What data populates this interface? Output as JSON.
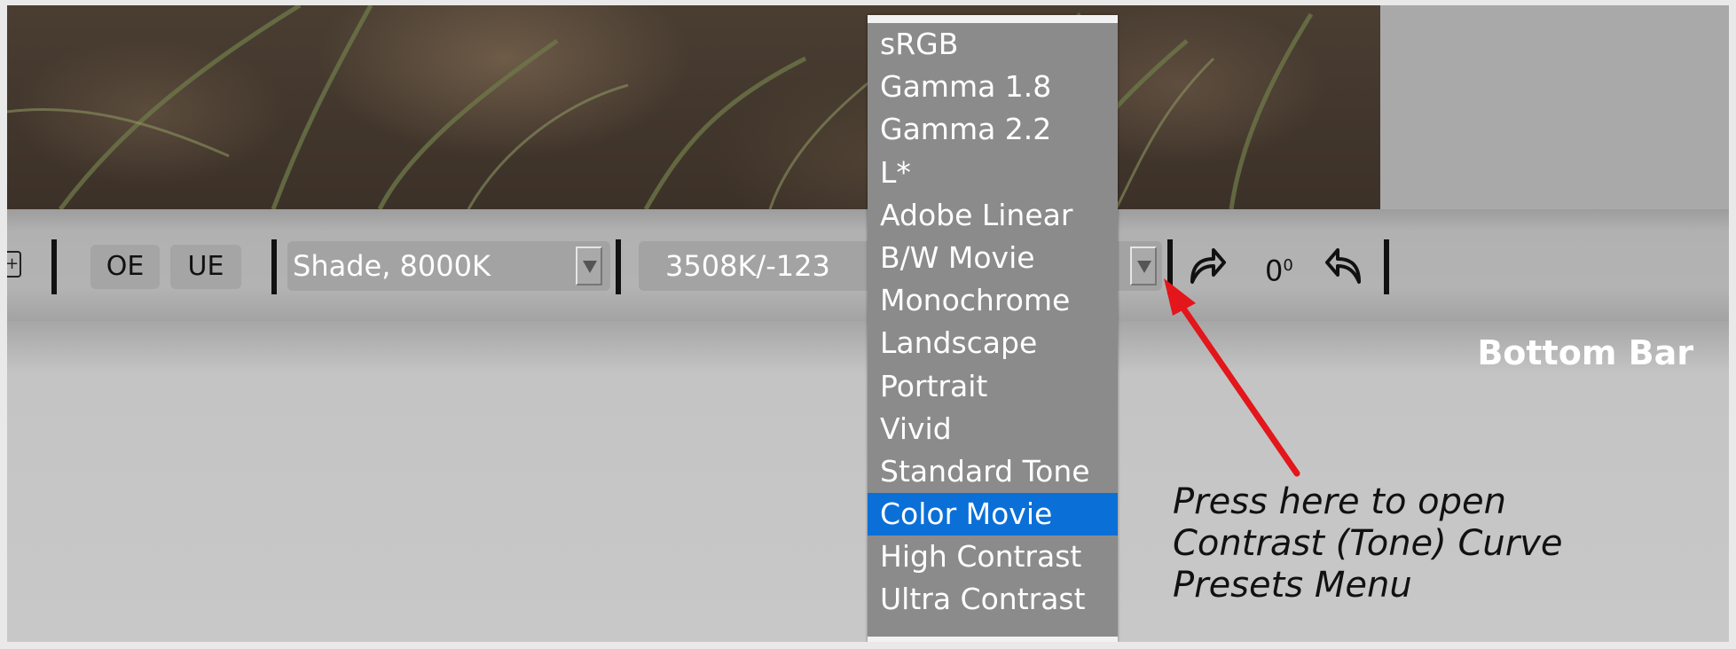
{
  "bottom_bar": {
    "oe_label": "OE",
    "ue_label": "UE",
    "wb_preset": "Shade, 8000K",
    "wb_value": "3508K/-123",
    "rotation": "0",
    "rotation_unit": "0"
  },
  "menu": {
    "items": [
      {
        "label": "sRGB"
      },
      {
        "label": "Gamma 1.8"
      },
      {
        "label": "Gamma 2.2"
      },
      {
        "label": "L*"
      },
      {
        "label": "Adobe Linear"
      },
      {
        "label": "B/W Movie"
      },
      {
        "label": "Monochrome"
      },
      {
        "label": "Landscape"
      },
      {
        "label": "Portrait"
      },
      {
        "label": "Vivid"
      },
      {
        "label": "Standard Tone"
      },
      {
        "label": "Color Movie"
      },
      {
        "label": "High Contrast"
      },
      {
        "label": "Ultra Contrast"
      }
    ],
    "selected": "Color Movie"
  },
  "annotation": {
    "section_label": "Bottom Bar",
    "note_line1": "Press here to open",
    "note_line2": "Contrast (Tone) Curve",
    "note_line3": "Presets Menu",
    "arrow_color": "#e3161b"
  },
  "colors": {
    "selection": "#0b6fd8",
    "menu_bg": "#8b8b8b"
  },
  "icons": [
    "expand-icon",
    "rotate-right-icon",
    "rotate-left-icon",
    "dropdown-arrow-icon"
  ]
}
